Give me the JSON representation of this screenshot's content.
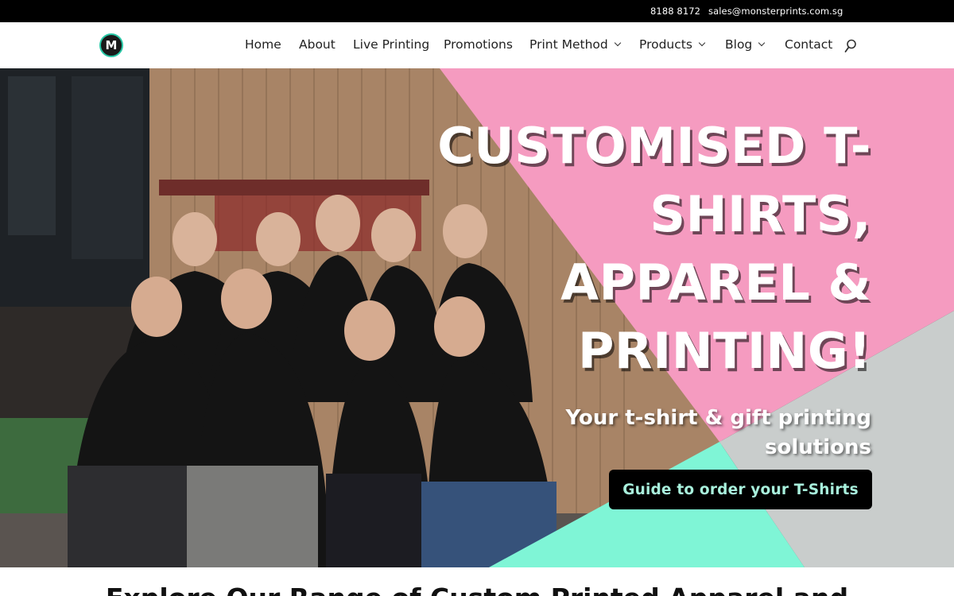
{
  "topbar": {
    "phone": "8188 8172",
    "email": "sales@monsterprints.com.sg"
  },
  "header": {
    "logo_letter": "M",
    "nav": [
      {
        "label": "Home",
        "dropdown": false
      },
      {
        "label": "About",
        "dropdown": false
      },
      {
        "label": "Live Printing",
        "dropdown": false
      },
      {
        "label": "Promotions",
        "dropdown": false
      },
      {
        "label": "Print Method",
        "dropdown": true
      },
      {
        "label": "Products",
        "dropdown": true
      },
      {
        "label": "Blog",
        "dropdown": true
      },
      {
        "label": "Contact",
        "dropdown": false
      }
    ],
    "search_icon": "search-icon"
  },
  "hero": {
    "headline_lines": [
      "CUSTOMISED T-",
      "SHIRTS,",
      "APPAREL &",
      "PRINTING!"
    ],
    "subline_lines": [
      "Your t-shirt & gift printing",
      "solutions"
    ],
    "cta_label": "Guide to order your T-Shirts",
    "colors": {
      "pink": "#f59bc0",
      "grey": "#c9cdcc",
      "mint": "#7ff5d6",
      "cta_bg": "#000000",
      "cta_text": "#a8f0dc"
    }
  },
  "section": {
    "title": "Explore Our Range of Custom Printed Apparel and"
  }
}
